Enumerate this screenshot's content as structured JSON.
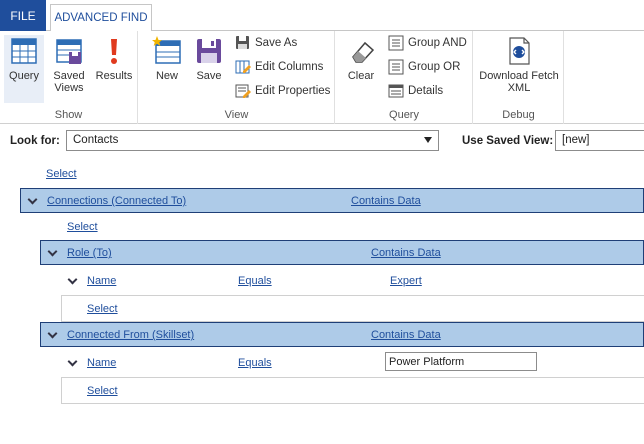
{
  "tabs": {
    "file": "FILE",
    "advanced_find": "ADVANCED FIND"
  },
  "ribbon": {
    "show": {
      "label": "Show",
      "query": "Query",
      "saved_views_1": "Saved",
      "saved_views_2": "Views",
      "results": "Results"
    },
    "view": {
      "label": "View",
      "new": "New",
      "save": "Save",
      "save_as": "Save As",
      "edit_columns": "Edit Columns",
      "edit_properties": "Edit Properties"
    },
    "query": {
      "label": "Query",
      "clear": "Clear",
      "group_and": "Group AND",
      "group_or": "Group OR",
      "details": "Details"
    },
    "debug": {
      "label": "Debug",
      "download_1": "Download Fetch",
      "download_2": "XML"
    }
  },
  "look_for": {
    "label": "Look for:",
    "value": "Contacts"
  },
  "saved_view": {
    "label": "Use Saved View:",
    "value": "[new]"
  },
  "query": {
    "top_select": "Select",
    "connections": {
      "field": "Connections (Connected To)",
      "operator": "Contains Data"
    },
    "conn_select": "Select",
    "role": {
      "field": "Role (To)",
      "operator": "Contains Data"
    },
    "role_name": {
      "field": "Name",
      "operator": "Equals",
      "value": "Expert"
    },
    "role_select": "Select",
    "connected_from": {
      "field": "Connected From (Skillset)",
      "operator": "Contains Data"
    },
    "from_name": {
      "field": "Name",
      "operator": "Equals",
      "value": "Power Platform"
    },
    "from_select": "Select"
  },
  "colors": {
    "file_tab": "#1f4e9c",
    "link": "#1f4e9c",
    "row_highlight": "#aecbe8",
    "row_border": "#1f3f77"
  }
}
